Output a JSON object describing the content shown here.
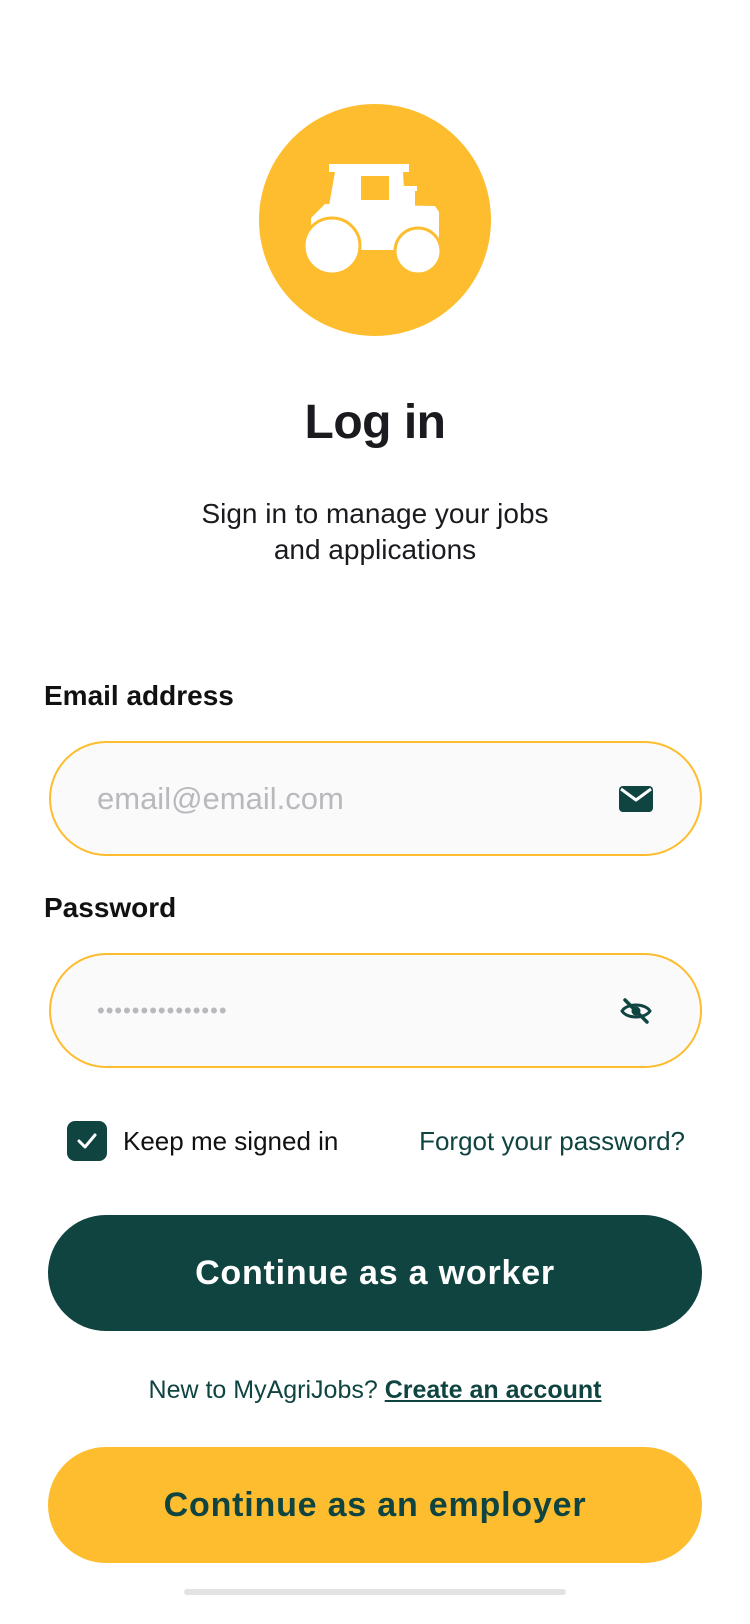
{
  "header": {
    "title": "Log in",
    "subtitle": "Sign in to manage your jobs and applications"
  },
  "email": {
    "label": "Email address",
    "placeholder": "email@email.com",
    "value": "",
    "icon": "envelope-icon"
  },
  "password": {
    "label": "Password",
    "masked_value": "•••••••••••••••",
    "icon": "eye-slash-icon"
  },
  "options": {
    "keep_signed_in_label": "Keep me signed in",
    "keep_signed_in_checked": true,
    "forgot_label": "Forgot your password?"
  },
  "actions": {
    "worker_label": "Continue as a worker",
    "signup_prefix": "New to MyAgriJobs?",
    "signup_link": "Create an account",
    "employer_label": "Continue as an employer"
  },
  "colors": {
    "accent_yellow": "#fdbd2e",
    "brand_green": "#0f4440"
  },
  "logo": {
    "icon": "tractor-icon"
  }
}
